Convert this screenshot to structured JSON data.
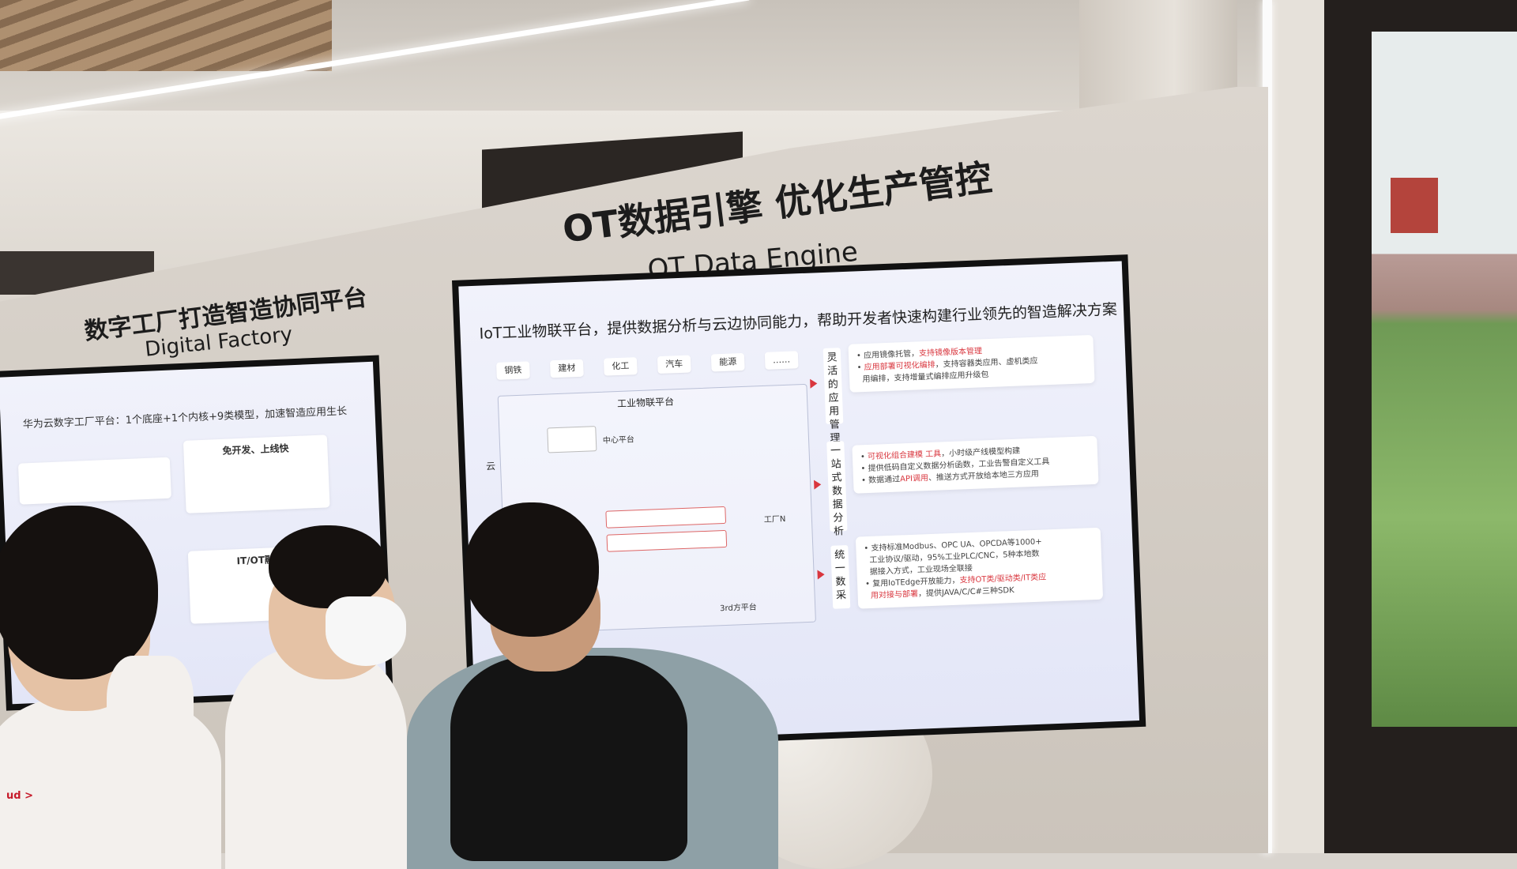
{
  "main_heading": {
    "chinese": "OT数据引擎 优化生产管控",
    "english": "OT Data Engine"
  },
  "left_heading": {
    "chinese": "数字工厂打造智造协同平台",
    "english": "Digital Factory"
  },
  "right_screen": {
    "title": "IoT工业物联平台，提供数据分析与云边协同能力，帮助开发者快速构建行业领先的智造解决方案",
    "industries": [
      "钢铁",
      "建材",
      "化工",
      "汽车",
      "能源",
      "……"
    ],
    "platform_label": "工业物联平台",
    "cloud_label": "云",
    "center_platform": "中心平台",
    "factory_label": "工厂N",
    "third_party": "3rd方平台",
    "sections": [
      {
        "label": "灵活的应用管理",
        "lines": [
          {
            "normal": "应用镜像托管，",
            "red": "支持镜像版本管理"
          },
          {
            "normal": "",
            "red": "应用部署可视化编排",
            "tail": "，支持容器类应用、虚机类应"
          },
          {
            "normal": "用编排，支持增量式编排应用升级包",
            "red": ""
          }
        ]
      },
      {
        "label": "一站式数据分析",
        "lines": [
          {
            "normal": "",
            "red": "可视化组合建模 工具",
            "tail": "，小时级产线模型构建"
          },
          {
            "normal": "提供低码自定义数据分析函数，工业告警自定义工具",
            "red": ""
          },
          {
            "normal": "数据通过",
            "red": "API调用",
            "tail": "、推送方式开放给本地三方应用"
          }
        ]
      },
      {
        "label": "统一数采",
        "lines": [
          {
            "normal": "支持标准Modbus、OPC UA、OPCDA等1000+",
            "red": ""
          },
          {
            "normal": "工业协议/驱动，95%工业PLC/CNC，5种本地数",
            "red": ""
          },
          {
            "normal": "据接入方式，工业现场全联接",
            "red": ""
          },
          {
            "normal": "复用IoTEdge开放能力，",
            "red": "支持OT类/驱动类/IT类应"
          },
          {
            "normal": "",
            "red": "用对接与部署",
            "tail": "，提供JAVA/C/C#三种SDK"
          }
        ]
      }
    ]
  },
  "left_screen": {
    "title": "华为云数字工厂平台：1个底座+1个内核+9类模型，加速智造应用生长",
    "card1_title": "免开发、上线快",
    "card2_title": "IT/OT融合"
  },
  "badge_text": "ud >",
  "colors": {
    "accent_red": "#d9363e",
    "screen_bg": "#e9ebf8",
    "panel": "#d6d0c8"
  }
}
